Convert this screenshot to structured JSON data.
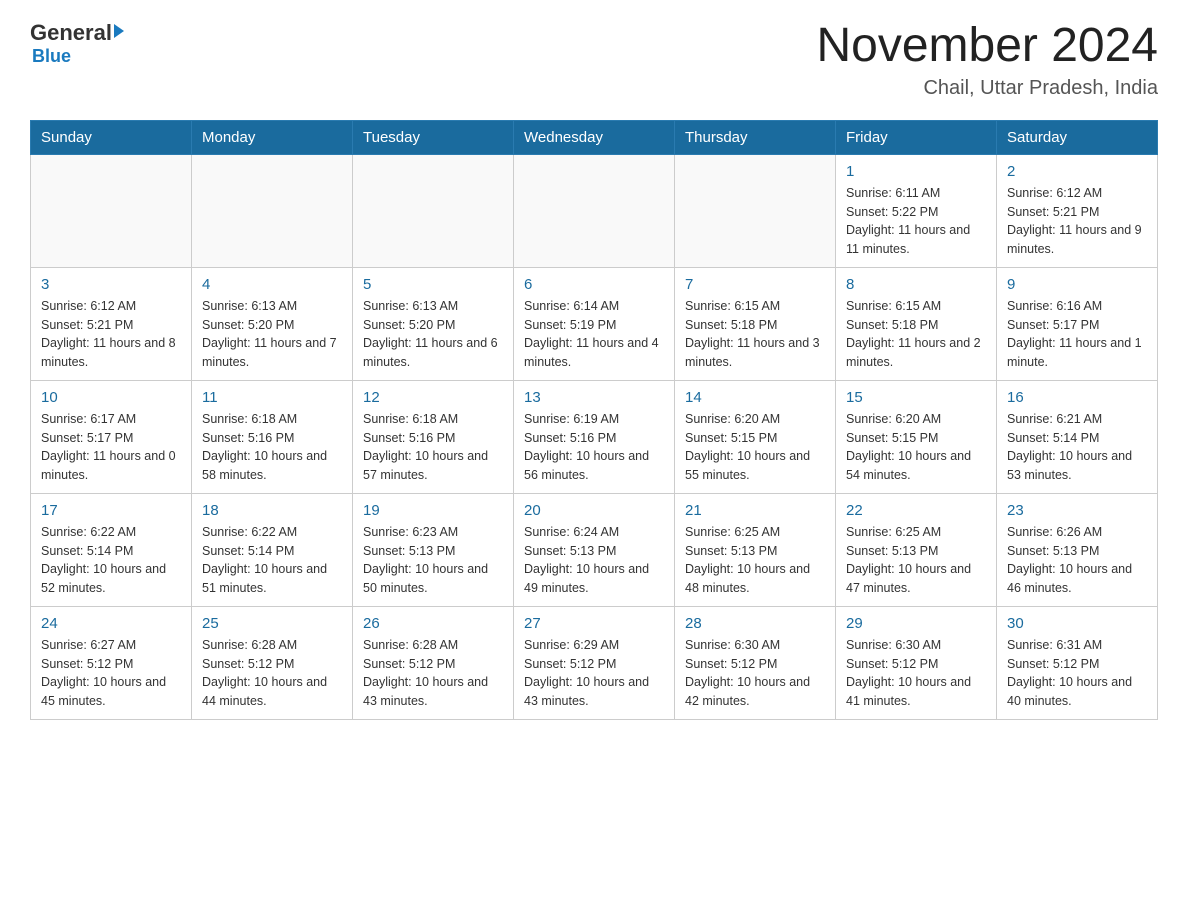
{
  "logo": {
    "general": "General",
    "blue": "Blue"
  },
  "header": {
    "title": "November 2024",
    "subtitle": "Chail, Uttar Pradesh, India"
  },
  "days_of_week": [
    "Sunday",
    "Monday",
    "Tuesday",
    "Wednesday",
    "Thursday",
    "Friday",
    "Saturday"
  ],
  "weeks": [
    [
      {
        "day": "",
        "sunrise": "",
        "sunset": "",
        "daylight": ""
      },
      {
        "day": "",
        "sunrise": "",
        "sunset": "",
        "daylight": ""
      },
      {
        "day": "",
        "sunrise": "",
        "sunset": "",
        "daylight": ""
      },
      {
        "day": "",
        "sunrise": "",
        "sunset": "",
        "daylight": ""
      },
      {
        "day": "",
        "sunrise": "",
        "sunset": "",
        "daylight": ""
      },
      {
        "day": "1",
        "sunrise": "Sunrise: 6:11 AM",
        "sunset": "Sunset: 5:22 PM",
        "daylight": "Daylight: 11 hours and 11 minutes."
      },
      {
        "day": "2",
        "sunrise": "Sunrise: 6:12 AM",
        "sunset": "Sunset: 5:21 PM",
        "daylight": "Daylight: 11 hours and 9 minutes."
      }
    ],
    [
      {
        "day": "3",
        "sunrise": "Sunrise: 6:12 AM",
        "sunset": "Sunset: 5:21 PM",
        "daylight": "Daylight: 11 hours and 8 minutes."
      },
      {
        "day": "4",
        "sunrise": "Sunrise: 6:13 AM",
        "sunset": "Sunset: 5:20 PM",
        "daylight": "Daylight: 11 hours and 7 minutes."
      },
      {
        "day": "5",
        "sunrise": "Sunrise: 6:13 AM",
        "sunset": "Sunset: 5:20 PM",
        "daylight": "Daylight: 11 hours and 6 minutes."
      },
      {
        "day": "6",
        "sunrise": "Sunrise: 6:14 AM",
        "sunset": "Sunset: 5:19 PM",
        "daylight": "Daylight: 11 hours and 4 minutes."
      },
      {
        "day": "7",
        "sunrise": "Sunrise: 6:15 AM",
        "sunset": "Sunset: 5:18 PM",
        "daylight": "Daylight: 11 hours and 3 minutes."
      },
      {
        "day": "8",
        "sunrise": "Sunrise: 6:15 AM",
        "sunset": "Sunset: 5:18 PM",
        "daylight": "Daylight: 11 hours and 2 minutes."
      },
      {
        "day": "9",
        "sunrise": "Sunrise: 6:16 AM",
        "sunset": "Sunset: 5:17 PM",
        "daylight": "Daylight: 11 hours and 1 minute."
      }
    ],
    [
      {
        "day": "10",
        "sunrise": "Sunrise: 6:17 AM",
        "sunset": "Sunset: 5:17 PM",
        "daylight": "Daylight: 11 hours and 0 minutes."
      },
      {
        "day": "11",
        "sunrise": "Sunrise: 6:18 AM",
        "sunset": "Sunset: 5:16 PM",
        "daylight": "Daylight: 10 hours and 58 minutes."
      },
      {
        "day": "12",
        "sunrise": "Sunrise: 6:18 AM",
        "sunset": "Sunset: 5:16 PM",
        "daylight": "Daylight: 10 hours and 57 minutes."
      },
      {
        "day": "13",
        "sunrise": "Sunrise: 6:19 AM",
        "sunset": "Sunset: 5:16 PM",
        "daylight": "Daylight: 10 hours and 56 minutes."
      },
      {
        "day": "14",
        "sunrise": "Sunrise: 6:20 AM",
        "sunset": "Sunset: 5:15 PM",
        "daylight": "Daylight: 10 hours and 55 minutes."
      },
      {
        "day": "15",
        "sunrise": "Sunrise: 6:20 AM",
        "sunset": "Sunset: 5:15 PM",
        "daylight": "Daylight: 10 hours and 54 minutes."
      },
      {
        "day": "16",
        "sunrise": "Sunrise: 6:21 AM",
        "sunset": "Sunset: 5:14 PM",
        "daylight": "Daylight: 10 hours and 53 minutes."
      }
    ],
    [
      {
        "day": "17",
        "sunrise": "Sunrise: 6:22 AM",
        "sunset": "Sunset: 5:14 PM",
        "daylight": "Daylight: 10 hours and 52 minutes."
      },
      {
        "day": "18",
        "sunrise": "Sunrise: 6:22 AM",
        "sunset": "Sunset: 5:14 PM",
        "daylight": "Daylight: 10 hours and 51 minutes."
      },
      {
        "day": "19",
        "sunrise": "Sunrise: 6:23 AM",
        "sunset": "Sunset: 5:13 PM",
        "daylight": "Daylight: 10 hours and 50 minutes."
      },
      {
        "day": "20",
        "sunrise": "Sunrise: 6:24 AM",
        "sunset": "Sunset: 5:13 PM",
        "daylight": "Daylight: 10 hours and 49 minutes."
      },
      {
        "day": "21",
        "sunrise": "Sunrise: 6:25 AM",
        "sunset": "Sunset: 5:13 PM",
        "daylight": "Daylight: 10 hours and 48 minutes."
      },
      {
        "day": "22",
        "sunrise": "Sunrise: 6:25 AM",
        "sunset": "Sunset: 5:13 PM",
        "daylight": "Daylight: 10 hours and 47 minutes."
      },
      {
        "day": "23",
        "sunrise": "Sunrise: 6:26 AM",
        "sunset": "Sunset: 5:13 PM",
        "daylight": "Daylight: 10 hours and 46 minutes."
      }
    ],
    [
      {
        "day": "24",
        "sunrise": "Sunrise: 6:27 AM",
        "sunset": "Sunset: 5:12 PM",
        "daylight": "Daylight: 10 hours and 45 minutes."
      },
      {
        "day": "25",
        "sunrise": "Sunrise: 6:28 AM",
        "sunset": "Sunset: 5:12 PM",
        "daylight": "Daylight: 10 hours and 44 minutes."
      },
      {
        "day": "26",
        "sunrise": "Sunrise: 6:28 AM",
        "sunset": "Sunset: 5:12 PM",
        "daylight": "Daylight: 10 hours and 43 minutes."
      },
      {
        "day": "27",
        "sunrise": "Sunrise: 6:29 AM",
        "sunset": "Sunset: 5:12 PM",
        "daylight": "Daylight: 10 hours and 43 minutes."
      },
      {
        "day": "28",
        "sunrise": "Sunrise: 6:30 AM",
        "sunset": "Sunset: 5:12 PM",
        "daylight": "Daylight: 10 hours and 42 minutes."
      },
      {
        "day": "29",
        "sunrise": "Sunrise: 6:30 AM",
        "sunset": "Sunset: 5:12 PM",
        "daylight": "Daylight: 10 hours and 41 minutes."
      },
      {
        "day": "30",
        "sunrise": "Sunrise: 6:31 AM",
        "sunset": "Sunset: 5:12 PM",
        "daylight": "Daylight: 10 hours and 40 minutes."
      }
    ]
  ]
}
